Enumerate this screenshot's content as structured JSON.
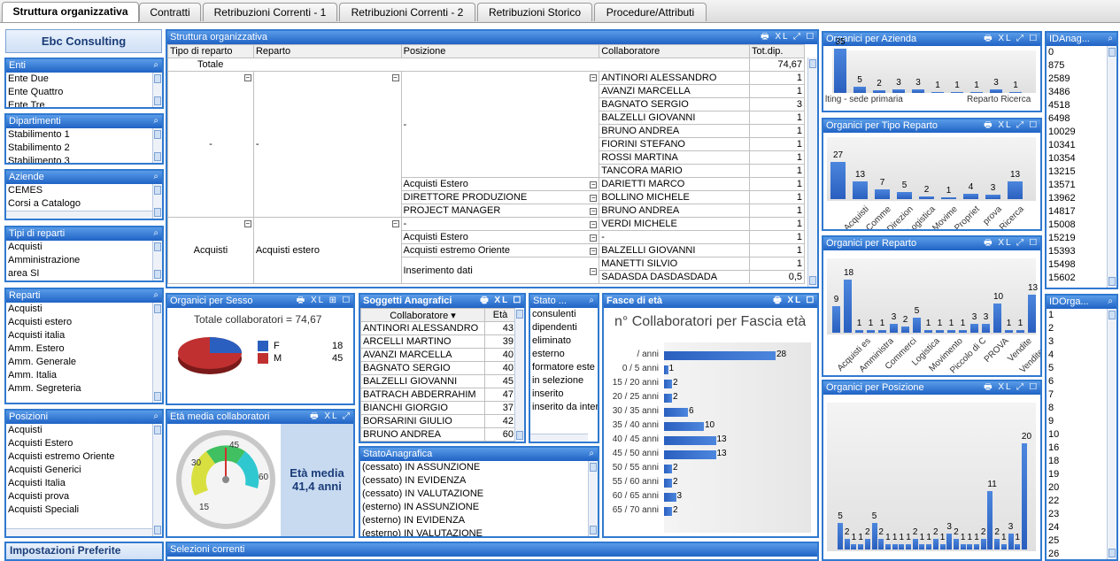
{
  "tabs": [
    "Struttura organizzativa",
    "Contratti",
    "Retribuzioni Correnti - 1",
    "Retribuzioni Correnti - 2",
    "Retribuzioni Storico",
    "Procedure/Attributi"
  ],
  "company": "Ebc Consulting",
  "lists": {
    "enti": {
      "title": "Enti",
      "items": [
        "Ente Due",
        "Ente Quattro",
        "Ente Tre"
      ]
    },
    "dip": {
      "title": "Dipartimenti",
      "items": [
        "Stabilimento 1",
        "Stabilimento 2",
        "Stabilimento 3"
      ]
    },
    "az": {
      "title": "Aziende",
      "items": [
        "CEMES",
        "Corsi a Catalogo"
      ]
    },
    "tipi": {
      "title": "Tipi di reparti",
      "items": [
        "Acquisti",
        "Amministrazione",
        "area SI"
      ]
    },
    "rep": {
      "title": "Reparti",
      "items": [
        "Acquisti",
        "Acquisti estero",
        "Acquisti italia",
        "Amm. Estero",
        "Amm. Generale",
        "Amm. Italia",
        "Amm. Segreteria"
      ]
    },
    "pos": {
      "title": "Posizioni",
      "items": [
        "",
        "Acquisti",
        "Acquisti Estero",
        "Acquisti estremo Oriente",
        "Acquisti Generici",
        "Acquisti Italia",
        "Acquisti prova",
        "Acquisti Speciali"
      ]
    },
    "imp": {
      "title": "Impostazioni Preferite"
    },
    "sel": {
      "title": "Selezioni correnti"
    }
  },
  "struttura": {
    "title": "Struttura organizzativa",
    "h": [
      "Tipo di reparto",
      "Reparto",
      "Posizione",
      "Collaboratore",
      "Tot.dip."
    ],
    "totale": "Totale",
    "tot": "74,67",
    "dash": "-",
    "collab": [
      [
        "ANTINORI ALESSANDRO",
        "1"
      ],
      [
        "AVANZI MARCELLA",
        "1"
      ],
      [
        "BAGNATO SERGIO",
        "3"
      ],
      [
        "BALZELLI GIOVANNI",
        "1"
      ],
      [
        "BRUNO ANDREA",
        "1"
      ],
      [
        "FIORINI STEFANO",
        "1"
      ],
      [
        "ROSSI  MARTINA",
        "1"
      ],
      [
        "TANCORA MARIO",
        "1"
      ]
    ],
    "pos": [
      [
        "Acquisti Estero",
        "DARIETTI MARCO",
        "1"
      ],
      [
        "DIRETTORE PRODUZIONE",
        "BOLLINO MICHELE",
        "1"
      ],
      [
        "PROJECT MANAGER",
        "BRUNO ANDREA",
        "1"
      ]
    ],
    "tipo2": "Acquisti",
    "rep2": "Acquisti estero",
    "pos2": [
      [
        "-",
        "VERDI  MICHELE",
        "1"
      ],
      [
        "Acquisti Estero",
        "-",
        "1"
      ],
      [
        "Acquisti estremo Oriente",
        "BALZELLI GIOVANNI",
        "1"
      ],
      [
        "Inserimento dati",
        "MANETTI SILVIO",
        "1"
      ],
      [
        "",
        "SADASDA DASDASDADA",
        "0,5"
      ]
    ]
  },
  "sesso": {
    "title": "Organici per Sesso",
    "total": "Totale collaboratori = 74,67",
    "legend": [
      {
        "k": "F",
        "v": "18",
        "c": "#2a5fbf"
      },
      {
        "k": "M",
        "v": "45",
        "c": "#c03030"
      }
    ]
  },
  "eta": {
    "title": "Età media collaboratori",
    "label": "Età media",
    "value": "41,4 anni",
    "ticks": [
      "15",
      "30",
      "45",
      "60"
    ]
  },
  "sogg": {
    "title": "Soggetti Anagrafici",
    "h": [
      "Collaboratore",
      "Età"
    ],
    "rows": [
      [
        "ANTINORI ALESSANDRO",
        "43"
      ],
      [
        "ARCELLI MARTINO",
        "39"
      ],
      [
        "AVANZI MARCELLA",
        "40"
      ],
      [
        "BAGNATO SERGIO",
        "40"
      ],
      [
        "BALZELLI GIOVANNI",
        "45"
      ],
      [
        "BATRACH ABDERRAHIM",
        "47"
      ],
      [
        "BIANCHI GIORGIO",
        "37"
      ],
      [
        "BORSARINI GIULIO",
        "42"
      ],
      [
        "BRUNO ANDREA",
        "60"
      ]
    ]
  },
  "stato": {
    "title": "Stato ...",
    "items": [
      "consulenti",
      "dipendenti",
      "eliminato",
      "esterno",
      "formatore este",
      "in selezione",
      "inserito",
      "inserito da inter"
    ]
  },
  "statoana": {
    "title": "StatoAnagrafica",
    "items": [
      "(cessato) IN ASSUNZIONE",
      "(cessato) IN EVIDENZA",
      "(cessato) IN VALUTAZIONE",
      "(esterno) IN ASSUNZIONE",
      "(esterno) IN EVIDENZA",
      "(esterno) IN VALUTAZIONE"
    ]
  },
  "fasce": {
    "title": "Fasce di età",
    "subtitle": "n° Collaboratori per Fascia età",
    "chart_data": {
      "type": "bar",
      "categories": [
        "/  anni",
        "0 / 5 anni",
        "15 / 20 anni",
        "20 / 25 anni",
        "30 / 35 anni",
        "35 / 40 anni",
        "40 / 45 anni",
        "45 / 50 anni",
        "50 / 55 anni",
        "55 / 60 anni",
        "60 / 65 anni",
        "65 / 70 anni"
      ],
      "values": [
        28,
        1,
        2,
        2,
        6,
        10,
        13,
        13,
        2,
        2,
        3,
        2
      ]
    }
  },
  "azienda": {
    "title": "Organici per Azienda",
    "chart_data": {
      "type": "bar",
      "values": [
        35,
        5,
        2,
        3,
        3,
        1,
        1,
        1,
        3,
        1
      ],
      "labels": [
        "lting - sede primaria",
        "Reparto Ricerca"
      ]
    }
  },
  "tipoRep": {
    "title": "Organici per Tipo Reparto",
    "chart_data": {
      "type": "bar",
      "values": [
        27,
        13,
        7,
        5,
        2,
        1,
        4,
        3,
        13
      ],
      "categories": [
        "Acquisti",
        "Comme",
        "Direzion",
        "Logistica",
        "Movime",
        "Propriet",
        "prova",
        "Ricerca",
        "-"
      ]
    }
  },
  "reparto": {
    "title": "Organici per Reparto",
    "chart_data": {
      "type": "bar",
      "values": [
        9,
        18,
        1,
        1,
        1,
        3,
        2,
        5,
        1,
        1,
        1,
        1,
        3,
        3,
        10,
        1,
        1,
        13
      ],
      "categories": [
        "Acquisti es",
        "Amministra",
        "Commerci",
        "Logistica",
        "Movimento",
        "Piccolo di C",
        "PROVA",
        "Vendite",
        "Vendite NO"
      ]
    }
  },
  "posizione": {
    "title": "Organici per Posizione",
    "chart_data": {
      "type": "bar",
      "values": [
        5,
        2,
        1,
        1,
        2,
        5,
        2,
        1,
        1,
        1,
        1,
        2,
        1,
        1,
        2,
        1,
        3,
        2,
        1,
        1,
        1,
        2,
        11,
        2,
        1,
        3,
        1,
        20
      ]
    }
  },
  "idanag": {
    "title": "IDAnag...",
    "items": [
      "0",
      "875",
      "2589",
      "3486",
      "4518",
      "6498",
      "10029",
      "10341",
      "10354",
      "13215",
      "13571",
      "13962",
      "14817",
      "15008",
      "15219",
      "15393",
      "15498",
      "15602"
    ]
  },
  "idorga": {
    "title": "IDOrga...",
    "items": [
      "1",
      "2",
      "3",
      "4",
      "5",
      "6",
      "7",
      "8",
      "9",
      "10",
      "16",
      "18",
      "19",
      "20",
      "22",
      "23",
      "24",
      "25",
      "26"
    ]
  }
}
